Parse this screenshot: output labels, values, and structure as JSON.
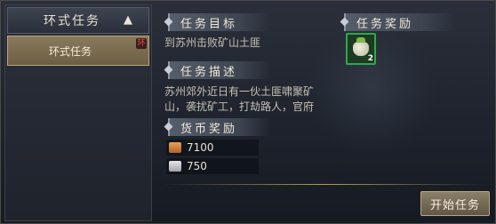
{
  "sidebar": {
    "category": {
      "label": "环式任务",
      "chevron_icon": "chevron-up-icon"
    },
    "items": [
      {
        "label": "环式任务",
        "badge": "环"
      }
    ]
  },
  "main": {
    "objective": {
      "title": "任务目标",
      "text": "到苏州击败矿山土匪"
    },
    "reward": {
      "title": "任务奖励",
      "item_icon": "item-bag-icon",
      "count": "2"
    },
    "description": {
      "title": "任务描述",
      "line1": "苏州郊外近日有一伙土匪啸聚矿",
      "line2": "山，袭扰矿工，打劫路人，官府"
    },
    "currency": {
      "title": "货币奖励",
      "rows": [
        {
          "icon": "copper-coin-icon",
          "value": "7100"
        },
        {
          "icon": "silver-ingot-icon",
          "value": "750"
        }
      ]
    },
    "start_button": "开始任务"
  },
  "colors": {
    "accent_green": "#2fa84a",
    "selected_item": "#8a7a5c"
  }
}
